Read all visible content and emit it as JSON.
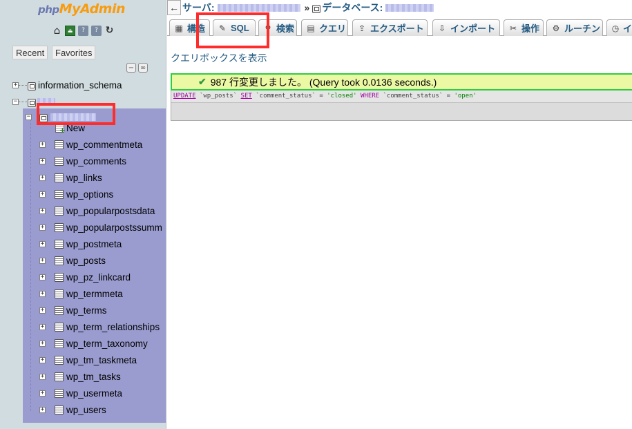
{
  "logo": {
    "php": "php",
    "myadmin": "MyAdmin"
  },
  "nav": {
    "recent_label": "Recent",
    "favorites_label": "Favorites",
    "collapse_symbol": "−",
    "link_symbol": "∞",
    "info_schema": "information_schema",
    "tables": [
      "New",
      "wp_commentmeta",
      "wp_comments",
      "wp_links",
      "wp_options",
      "wp_popularpostsdata",
      "wp_popularpostssumm",
      "wp_postmeta",
      "wp_posts",
      "wp_pz_linkcard",
      "wp_termmeta",
      "wp_terms",
      "wp_term_relationships",
      "wp_term_taxonomy",
      "wp_tm_taskmeta",
      "wp_tm_tasks",
      "wp_usermeta",
      "wp_users"
    ],
    "expander_plus": "+",
    "expander_minus": "−"
  },
  "breadcrumb": {
    "back": "←",
    "server_label": "サーバ:",
    "separator": "»",
    "database_label": "データベース:"
  },
  "tabs": [
    {
      "label": "構造",
      "icon": "structure-icon",
      "glyph": "▦"
    },
    {
      "label": "SQL",
      "icon": "sql-icon",
      "glyph": "✎"
    },
    {
      "label": "検索",
      "icon": "search-icon",
      "glyph": "⚲"
    },
    {
      "label": "クエリ",
      "icon": "query-icon",
      "glyph": "▤"
    },
    {
      "label": "エクスポート",
      "icon": "export-icon",
      "glyph": "⇪"
    },
    {
      "label": "インポート",
      "icon": "import-icon",
      "glyph": "⇩"
    },
    {
      "label": "操作",
      "icon": "operations-icon",
      "glyph": "✂"
    },
    {
      "label": "ルーチン",
      "icon": "routines-icon",
      "glyph": "⚙"
    },
    {
      "label": "イ",
      "icon": "events-icon",
      "glyph": "◷"
    }
  ],
  "main": {
    "query_box_link": "クエリボックスを表示",
    "success_message": "987 行変更しました。 (Query took 0.0136 seconds.)",
    "check_glyph": "✔",
    "sql": {
      "kw_update": "UPDATE",
      "table": "`wp_posts`",
      "kw_set": "SET",
      "col1": "`comment_status`",
      "eq": "=",
      "val1": "'closed'",
      "kw_where": "WHERE",
      "col2": "`comment_status`",
      "val2": "'open'"
    }
  },
  "colors": {
    "nav_bg": "#d0dce0",
    "db_group_bg": "#9a9ccf",
    "link_blue": "#235a81",
    "success_border": "#2ecc40",
    "success_bg": "#ebf8a4",
    "highlight_red": "#ff2c2c"
  }
}
